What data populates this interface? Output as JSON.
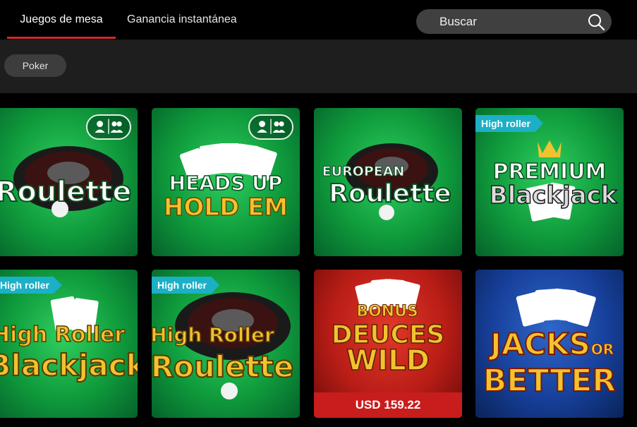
{
  "tabs": [
    {
      "label": "Juegos de mesa",
      "active": true
    },
    {
      "label": "Ganancia instantánea",
      "active": false
    }
  ],
  "search": {
    "placeholder": "Buscar",
    "icon": "search-icon"
  },
  "filters": [
    {
      "label": "Poker"
    }
  ],
  "colors": {
    "accent": "#d4282c",
    "badge": "#1bb0c6",
    "price_bar": "#c81d1d"
  },
  "games": [
    {
      "title_lines": [
        "Roulette"
      ],
      "multiplayer_icon": true
    },
    {
      "title_lines": [
        "HEADS UP",
        "HOLD EM"
      ],
      "multiplayer_icon": true
    },
    {
      "title_lines": [
        "EUROPEAN",
        "Roulette"
      ]
    },
    {
      "badge": "High roller",
      "title_lines": [
        "PREMIUM",
        "Blackjack"
      ]
    },
    {
      "badge": "High roller",
      "title_lines": [
        "High Roller",
        "Blackjack"
      ]
    },
    {
      "badge": "High roller",
      "title_lines": [
        "High Roller",
        "Roulette"
      ]
    },
    {
      "title_lines": [
        "BONUS",
        "DEUCES",
        "WILD"
      ],
      "price": "USD 159.22"
    },
    {
      "title_lines": [
        "JACKS",
        "OR",
        "BETTER"
      ]
    }
  ]
}
